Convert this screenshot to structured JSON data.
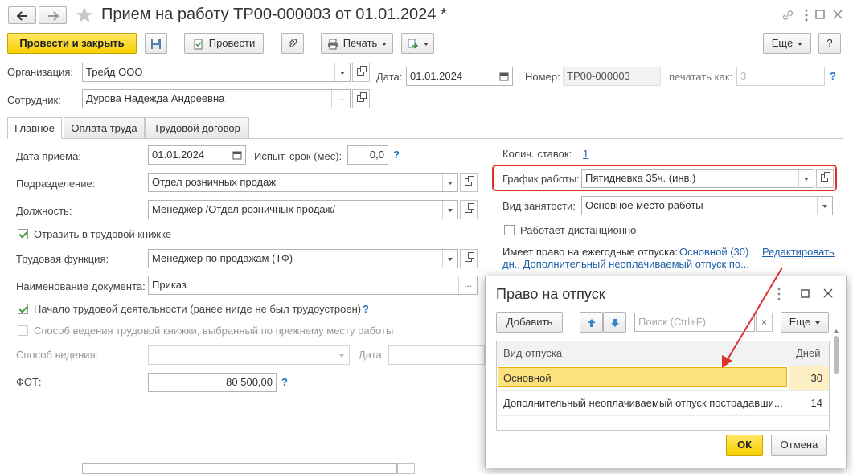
{
  "window": {
    "title": "Прием на работу ТР00-000003 от 01.01.2024 *"
  },
  "toolbar": {
    "post_close": "Провести и закрыть",
    "post": "Провести",
    "print": "Печать",
    "more": "Еще",
    "help": "?"
  },
  "header": {
    "org_label": "Организация:",
    "org_value": "Трейд ООО",
    "date_label": "Дата:",
    "date_value": "01.01.2024",
    "number_label": "Номер:",
    "number_value": "ТР00-000003",
    "printas_label": "печатать как:",
    "printas_value": "3",
    "employee_label": "Сотрудник:",
    "employee_value": "Дурова Надежда Андреевна"
  },
  "tabs": [
    "Главное",
    "Оплата труда",
    "Трудовой договор"
  ],
  "main": {
    "hire_date_label": "Дата приема:",
    "hire_date_value": "01.01.2024",
    "probation_label": "Испыт. срок (мес):",
    "probation_value": "0,0",
    "division_label": "Подразделение:",
    "division_value": "Отдел розничных продаж",
    "position_label": "Должность:",
    "position_value": "Менеджер /Отдел розничных продаж/",
    "reflect_label": "Отразить в трудовой книжке",
    "function_label": "Трудовая функция:",
    "function_value": "Менеджер по продажам (ТФ)",
    "docname_label": "Наименование документа:",
    "docname_value": "Приказ",
    "start_label": "Начало трудовой деятельности (ранее нигде не был трудоустроен)",
    "method_prev_label": "Способ ведения трудовой книжки, выбранный по прежнему месту работы",
    "method_label": "Способ ведения:",
    "method_date_label": "Дата:",
    "method_date_value": " .  .",
    "fot_label": "ФОТ:",
    "fot_value": "80 500,00"
  },
  "right": {
    "rates_label": "Колич. ставок:",
    "rates_value": "1",
    "schedule_label": "График работы:",
    "schedule_value": "Пятидневка 35ч. (инв.)",
    "employment_label": "Вид занятости:",
    "employment_value": "Основное место работы",
    "remote_label": "Работает дистанционно",
    "vacation_prefix": "Имеет право на ежегодные отпуска:",
    "vacation_line1": "Основной (30)",
    "vacation_line2": "дн., Дополнительный неоплачиваемый отпуск по...",
    "edit_link": "Редактировать"
  },
  "dialog": {
    "title": "Право на отпуск",
    "add": "Добавить",
    "search_placeholder": "Поиск (Ctrl+F)",
    "more": "Еще",
    "col_type": "Вид отпуска",
    "col_days": "Дней",
    "rows": [
      {
        "type": "Основной",
        "days": "30"
      },
      {
        "type": "Дополнительный неоплачиваемый отпуск пострадавши...",
        "days": "14"
      }
    ],
    "ok": "ОК",
    "cancel": "Отмена"
  },
  "colors": {
    "accent_yellow": "#f7ce00",
    "highlight_red": "#d9332b",
    "link_blue": "#1c5fa8",
    "selected_row": "#fbe27c"
  }
}
